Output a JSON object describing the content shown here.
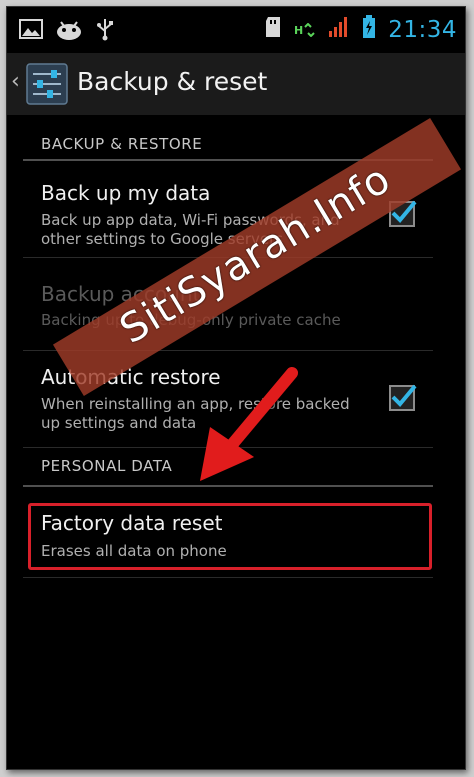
{
  "statusbar": {
    "left_icons": [
      "gallery-icon",
      "android-icon",
      "usb-icon"
    ],
    "right_icons": [
      "sdcard-icon",
      "data-transfer-icon",
      "signal-icon",
      "battery-icon"
    ],
    "time": "21:34"
  },
  "actionbar": {
    "title": "Backup & reset"
  },
  "sections": [
    {
      "label": "BACKUP & RESTORE"
    },
    {
      "label": "PERSONAL DATA"
    }
  ],
  "items": [
    {
      "title": "Back up my data",
      "summary": "Back up app data, Wi-Fi passwords, and other settings to Google servers",
      "checked": true,
      "enabled": true
    },
    {
      "title": "Backup account",
      "summary": "Backing up to debug-only private cache",
      "enabled": false
    },
    {
      "title": "Automatic restore",
      "summary": "When reinstalling an app, restore backed up settings and data",
      "checked": true,
      "enabled": true
    },
    {
      "title": "Factory data reset",
      "summary": "Erases all data on phone",
      "enabled": true
    }
  ],
  "watermark": "SitiSyarah.Info",
  "colors": {
    "accent": "#33b5e5",
    "highlight": "#d8202a",
    "watermark_bg": "#a03c28"
  }
}
